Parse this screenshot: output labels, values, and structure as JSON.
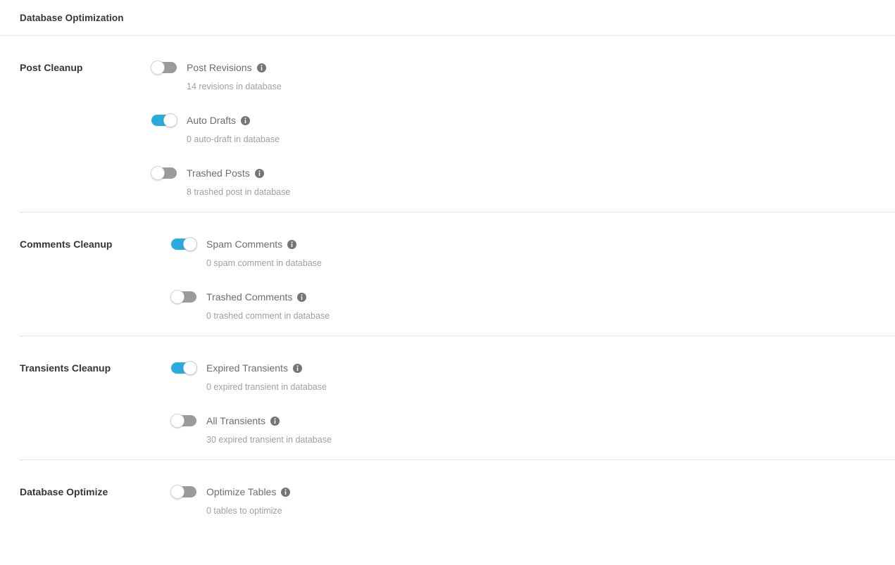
{
  "header": {
    "title": "Database Optimization"
  },
  "colors": {
    "accent": "#29abe2",
    "toggle_off": "#9b9b9b",
    "label": "#6e6e6e",
    "sublabel": "#a0a0a0",
    "section_label": "#32373c",
    "divider": "#e4e4e6",
    "info_icon": "#757575"
  },
  "icons": {
    "info": "info-icon"
  },
  "sections": [
    {
      "label": "Post Cleanup",
      "fields": [
        {
          "label": "Post Revisions",
          "sub": "14 revisions in database",
          "enabled": false
        },
        {
          "label": "Auto Drafts",
          "sub": "0 auto-draft in database",
          "enabled": true
        },
        {
          "label": "Trashed Posts",
          "sub": "8 trashed post in database",
          "enabled": false
        }
      ]
    },
    {
      "label": "Comments Cleanup",
      "fields": [
        {
          "label": "Spam Comments",
          "sub": "0 spam comment in database",
          "enabled": true
        },
        {
          "label": "Trashed Comments",
          "sub": "0 trashed comment in database",
          "enabled": false
        }
      ]
    },
    {
      "label": "Transients Cleanup",
      "fields": [
        {
          "label": "Expired Transients",
          "sub": "0 expired transient in database",
          "enabled": true
        },
        {
          "label": "All Transients",
          "sub": "30 expired transient in database",
          "enabled": false
        }
      ]
    },
    {
      "label": "Database Optimize",
      "fields": [
        {
          "label": "Optimize Tables",
          "sub": "0 tables to optimize",
          "enabled": false
        }
      ]
    }
  ]
}
